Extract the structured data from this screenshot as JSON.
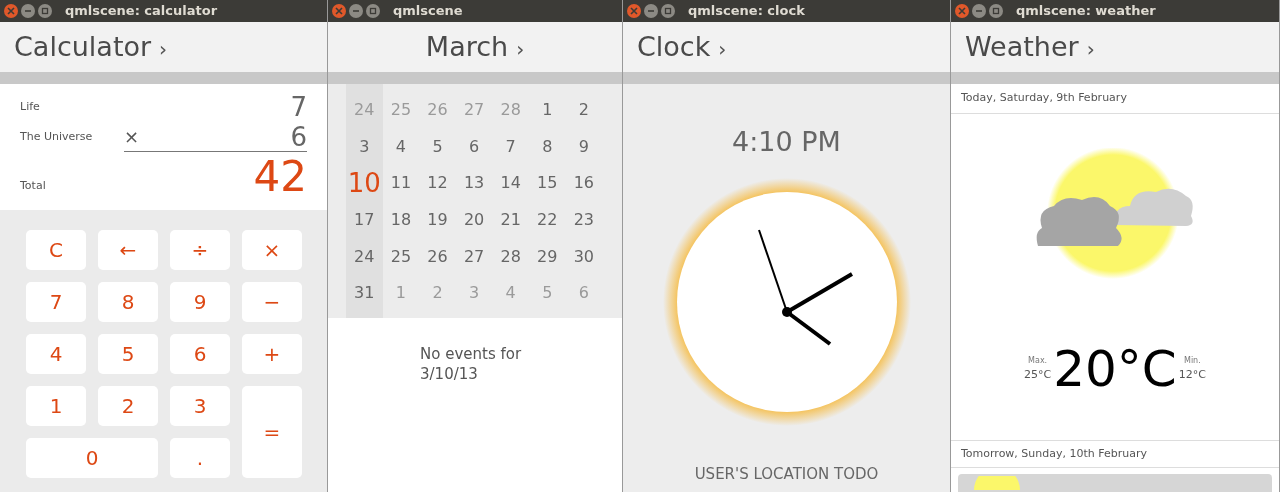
{
  "windows": [
    {
      "kind": "calculator",
      "title": "qmlscene: calculator",
      "header": "Calculator",
      "chevron": "›",
      "operands": [
        {
          "label": "Life",
          "value": "7"
        },
        {
          "label": "The Universe",
          "operator": "×",
          "value": "6"
        }
      ],
      "total": {
        "label": "Total",
        "value": "42"
      },
      "keys": [
        {
          "label": "C",
          "kind": "normal"
        },
        {
          "label": "←",
          "kind": "normal"
        },
        {
          "label": "÷",
          "kind": "normal"
        },
        {
          "label": "×",
          "kind": "normal"
        },
        {
          "label": "7",
          "kind": "normal"
        },
        {
          "label": "8",
          "kind": "normal"
        },
        {
          "label": "9",
          "kind": "normal"
        },
        {
          "label": "−",
          "kind": "normal"
        },
        {
          "label": "4",
          "kind": "normal"
        },
        {
          "label": "5",
          "kind": "normal"
        },
        {
          "label": "6",
          "kind": "normal"
        },
        {
          "label": "+",
          "kind": "normal"
        },
        {
          "label": "1",
          "kind": "normal"
        },
        {
          "label": "2",
          "kind": "normal"
        },
        {
          "label": "3",
          "kind": "normal"
        },
        {
          "label": "=",
          "kind": "tall"
        },
        {
          "label": "0",
          "kind": "wide"
        },
        {
          "label": ".",
          "kind": "normal"
        }
      ]
    },
    {
      "kind": "calendar",
      "title": "qmlscene",
      "header": "March",
      "chevron": "›",
      "days": [
        {
          "label": "24",
          "kind": "other",
          "selected": false
        },
        {
          "label": "25",
          "kind": "other",
          "selected": false
        },
        {
          "label": "26",
          "kind": "other",
          "selected": false
        },
        {
          "label": "27",
          "kind": "other",
          "selected": false
        },
        {
          "label": "28",
          "kind": "other",
          "selected": false
        },
        {
          "label": "1",
          "kind": "current",
          "selected": false
        },
        {
          "label": "2",
          "kind": "current",
          "selected": false
        },
        {
          "label": "3",
          "kind": "current",
          "selected": false
        },
        {
          "label": "4",
          "kind": "current",
          "selected": false
        },
        {
          "label": "5",
          "kind": "current",
          "selected": false
        },
        {
          "label": "6",
          "kind": "current",
          "selected": false
        },
        {
          "label": "7",
          "kind": "current",
          "selected": false
        },
        {
          "label": "8",
          "kind": "current",
          "selected": false
        },
        {
          "label": "9",
          "kind": "current",
          "selected": false
        },
        {
          "label": "10",
          "kind": "current",
          "selected": true
        },
        {
          "label": "11",
          "kind": "current",
          "selected": false
        },
        {
          "label": "12",
          "kind": "current",
          "selected": false
        },
        {
          "label": "13",
          "kind": "current",
          "selected": false
        },
        {
          "label": "14",
          "kind": "current",
          "selected": false
        },
        {
          "label": "15",
          "kind": "current",
          "selected": false
        },
        {
          "label": "16",
          "kind": "current",
          "selected": false
        },
        {
          "label": "17",
          "kind": "current",
          "selected": false
        },
        {
          "label": "18",
          "kind": "current",
          "selected": false
        },
        {
          "label": "19",
          "kind": "current",
          "selected": false
        },
        {
          "label": "20",
          "kind": "current",
          "selected": false
        },
        {
          "label": "21",
          "kind": "current",
          "selected": false
        },
        {
          "label": "22",
          "kind": "current",
          "selected": false
        },
        {
          "label": "23",
          "kind": "current",
          "selected": false
        },
        {
          "label": "24",
          "kind": "current",
          "selected": false
        },
        {
          "label": "25",
          "kind": "current",
          "selected": false
        },
        {
          "label": "26",
          "kind": "current",
          "selected": false
        },
        {
          "label": "27",
          "kind": "current",
          "selected": false
        },
        {
          "label": "28",
          "kind": "current",
          "selected": false
        },
        {
          "label": "29",
          "kind": "current",
          "selected": false
        },
        {
          "label": "30",
          "kind": "current",
          "selected": false
        },
        {
          "label": "31",
          "kind": "current",
          "selected": false
        },
        {
          "label": "1",
          "kind": "other",
          "selected": false
        },
        {
          "label": "2",
          "kind": "other",
          "selected": false
        },
        {
          "label": "3",
          "kind": "other",
          "selected": false
        },
        {
          "label": "4",
          "kind": "other",
          "selected": false
        },
        {
          "label": "5",
          "kind": "other",
          "selected": false
        },
        {
          "label": "6",
          "kind": "other",
          "selected": false
        }
      ],
      "events_message": "No events for 3/10/13"
    },
    {
      "kind": "clock",
      "title": "qmlscene: clock",
      "header": "Clock",
      "chevron": "›",
      "time": "4:10 PM",
      "location": "USER'S LOCATION TODO"
    },
    {
      "kind": "weather",
      "title": "qmlscene: weather",
      "header": "Weather",
      "chevron": "›",
      "today": {
        "heading": "Today, Saturday, 9th February",
        "max_label": "Max.",
        "max": "25°C",
        "temperature": "20°C",
        "min_label": "Min.",
        "min": "12°C"
      },
      "tomorrow": {
        "heading": "Tomorrow, Sunday, 10th February"
      }
    }
  ]
}
